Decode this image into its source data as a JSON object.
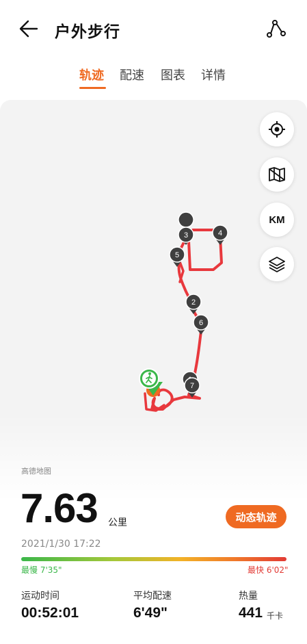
{
  "header": {
    "title": "户外步行",
    "back_icon": "arrow-left-icon",
    "route_icon": "route-share-icon"
  },
  "tabs": [
    {
      "label": "轨迹",
      "active": true
    },
    {
      "label": "配速",
      "active": false
    },
    {
      "label": "图表",
      "active": false
    },
    {
      "label": "详情",
      "active": false
    }
  ],
  "map": {
    "provider": "高德地图",
    "controls": {
      "locate_icon": "locate-icon",
      "map_type_icon": "map-icon",
      "km_label": "KM",
      "layers_icon": "layers-icon"
    },
    "markers": [
      "1",
      "2",
      "3",
      "4",
      "5",
      "6",
      "7"
    ],
    "start_icon": "walker-start-icon",
    "track_color": "#e8383d"
  },
  "summary": {
    "distance": "7.63",
    "distance_unit": "公里",
    "dynamic_button": "动态轨迹",
    "date": "2021/1/30 17:22",
    "slowest": "最慢 7'35\"",
    "fastest": "最快 6'02\""
  },
  "stats": [
    {
      "label": "运动时间",
      "value": "00:52:01",
      "unit": ""
    },
    {
      "label": "平均配速",
      "value": "6'49\"",
      "unit": ""
    },
    {
      "label": "热量",
      "value": "441",
      "unit": "千卡"
    }
  ],
  "colors": {
    "accent": "#ef6a22",
    "slow": "#3bb74a",
    "fast": "#e23b35"
  }
}
